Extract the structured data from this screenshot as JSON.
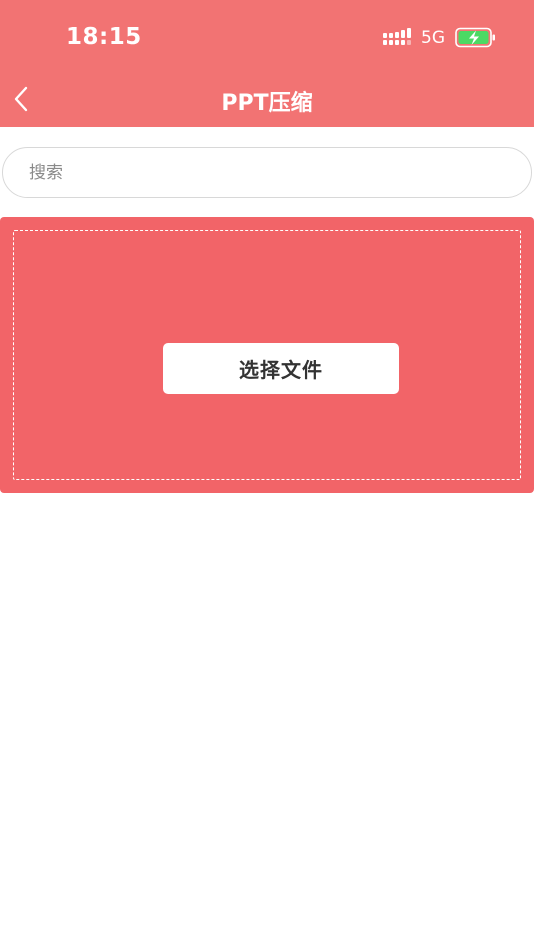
{
  "status_bar": {
    "time": "18:15",
    "network": "5G",
    "battery_color": "#4cd964",
    "icons": [
      "signal-icon",
      "battery-charging-icon"
    ]
  },
  "nav": {
    "title": "PPT压缩",
    "back_icon": "chevron-left-icon"
  },
  "search": {
    "placeholder": "搜索",
    "value": ""
  },
  "upload": {
    "button_label": "选择文件"
  },
  "colors": {
    "header_bg": "#f27373",
    "panel_bg": "#f26468",
    "text_white": "#ffffff"
  }
}
